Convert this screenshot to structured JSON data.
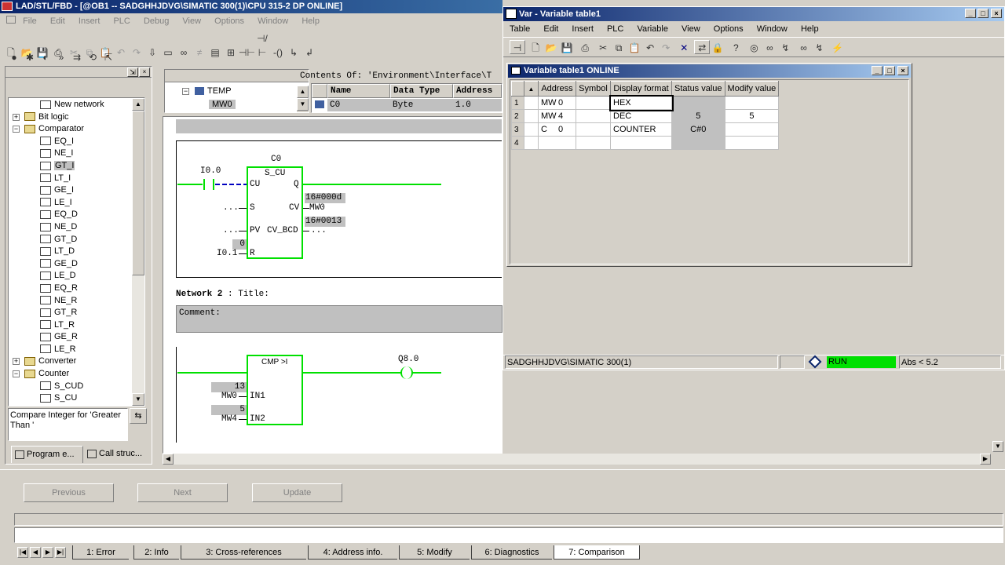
{
  "main_window": {
    "title": "LAD/STL/FBD  - [@OB1 -- SADGHHJDVG\\SIMATIC 300(1)\\CPU 315-2 DP  ONLINE]",
    "menu": [
      "File",
      "Edit",
      "Insert",
      "PLC",
      "Debug",
      "View",
      "Options",
      "Window",
      "Help"
    ]
  },
  "catalog": {
    "items": [
      {
        "label": "New network",
        "depth": 1,
        "icon": "network-icon"
      },
      {
        "label": "Bit logic",
        "depth": 0,
        "icon": "folder-icon",
        "expander": "+"
      },
      {
        "label": "Comparator",
        "depth": 0,
        "icon": "folder-icon",
        "expander": "-"
      },
      {
        "label": "EQ_I",
        "depth": 1,
        "icon": "block-icon"
      },
      {
        "label": "NE_I",
        "depth": 1,
        "icon": "block-icon"
      },
      {
        "label": "GT_I",
        "depth": 1,
        "icon": "block-icon",
        "selected": true
      },
      {
        "label": "LT_I",
        "depth": 1,
        "icon": "block-icon"
      },
      {
        "label": "GE_I",
        "depth": 1,
        "icon": "block-icon"
      },
      {
        "label": "LE_I",
        "depth": 1,
        "icon": "block-icon"
      },
      {
        "label": "EQ_D",
        "depth": 1,
        "icon": "block-icon"
      },
      {
        "label": "NE_D",
        "depth": 1,
        "icon": "block-icon"
      },
      {
        "label": "GT_D",
        "depth": 1,
        "icon": "block-icon"
      },
      {
        "label": "LT_D",
        "depth": 1,
        "icon": "block-icon"
      },
      {
        "label": "GE_D",
        "depth": 1,
        "icon": "block-icon"
      },
      {
        "label": "LE_D",
        "depth": 1,
        "icon": "block-icon"
      },
      {
        "label": "EQ_R",
        "depth": 1,
        "icon": "block-icon"
      },
      {
        "label": "NE_R",
        "depth": 1,
        "icon": "block-icon"
      },
      {
        "label": "GT_R",
        "depth": 1,
        "icon": "block-icon"
      },
      {
        "label": "LT_R",
        "depth": 1,
        "icon": "block-icon"
      },
      {
        "label": "GE_R",
        "depth": 1,
        "icon": "block-icon"
      },
      {
        "label": "LE_R",
        "depth": 1,
        "icon": "block-icon"
      },
      {
        "label": "Converter",
        "depth": 0,
        "icon": "folder-icon",
        "expander": "+"
      },
      {
        "label": "Counter",
        "depth": 0,
        "icon": "folder-icon",
        "expander": "-"
      },
      {
        "label": "S_CUD",
        "depth": 1,
        "icon": "block-icon"
      },
      {
        "label": "S_CU",
        "depth": 1,
        "icon": "block-icon"
      }
    ],
    "description": "Compare Integer for  'Greater Than '",
    "tabs": [
      "Program e...",
      "Call struc..."
    ]
  },
  "interface": {
    "tree_item": "TEMP",
    "tree_child": "MW0",
    "contents_of": "Contents Of: 'Environment\\Interface\\T",
    "columns": [
      "Name",
      "Data Type",
      "Address"
    ],
    "row": {
      "name": "C0",
      "type": "Byte",
      "address": "1.0"
    }
  },
  "network1": {
    "counter": "C0",
    "block": "S_CU",
    "pins": {
      "cu": "CU",
      "s": "S",
      "pv": "PV",
      "r": "R",
      "q": "Q",
      "cv": "CV",
      "cv_bcd": "CV_BCD"
    },
    "contact": "I0.0",
    "s_input": "...",
    "pv_input": "...",
    "r_value": "0",
    "r_input": "I0.1",
    "cv_value": "16#000d",
    "cv_operand": "MW0",
    "bcd_value": "16#0013",
    "bcd_operand": "..."
  },
  "network2": {
    "header_label": "Network 2",
    "header_title": ": Title:",
    "comment": "Comment:",
    "block": "CMP >I",
    "in1": "IN1",
    "in2": "IN2",
    "in1_value": "13",
    "in1_operand": "MW0",
    "in2_value": "5",
    "in2_operand": "MW4",
    "coil": "Q8.0"
  },
  "var_window": {
    "title": "Var - Variable table1",
    "menu": [
      "Table",
      "Edit",
      "Insert",
      "PLC",
      "Variable",
      "View",
      "Options",
      "Window",
      "Help"
    ],
    "child_title": "Variable table1  ONLINE",
    "columns": [
      "Address",
      "Symbol",
      "Display format",
      "Status value",
      "Modify value"
    ],
    "rows": [
      {
        "num": "1",
        "area": "MW",
        "index": "0",
        "symbol": "",
        "format": "HEX",
        "status": "",
        "modify": ""
      },
      {
        "num": "2",
        "area": "MW",
        "index": "4",
        "symbol": "",
        "format": "DEC",
        "status": "5",
        "modify": "5"
      },
      {
        "num": "3",
        "area": "C",
        "index": "0",
        "symbol": "",
        "format": "COUNTER",
        "status": "C#0",
        "modify": ""
      },
      {
        "num": "4",
        "area": "",
        "index": "",
        "symbol": "",
        "format": "",
        "status": "",
        "modify": ""
      }
    ],
    "status_path": "SADGHHJDVG\\SIMATIC 300(1)",
    "run": "RUN",
    "abs": "Abs < 5.2",
    "run_color": "#00e000"
  },
  "bottom": {
    "buttons": {
      "previous": "Previous",
      "next": "Next",
      "update": "Update"
    },
    "tabs": [
      "1: Error",
      "2: Info",
      "3: Cross-references",
      "4: Address info.",
      "5: Modify",
      "6: Diagnostics",
      "7: Comparison"
    ]
  }
}
